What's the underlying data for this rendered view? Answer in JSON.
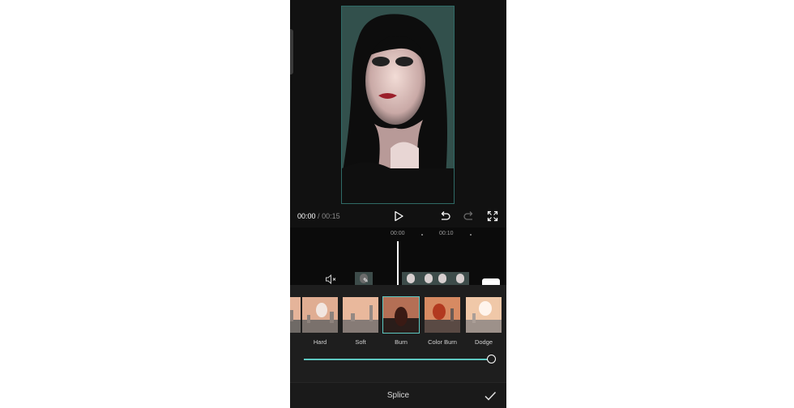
{
  "player": {
    "current_time": "00:00",
    "separator": "/",
    "total_time": "00:15"
  },
  "timeline": {
    "ruler": [
      "00:00",
      "00:10"
    ]
  },
  "blend_modes": {
    "items": [
      {
        "label": "Hard",
        "selected": false
      },
      {
        "label": "Soft",
        "selected": false
      },
      {
        "label": "Burn",
        "selected": true
      },
      {
        "label": "Color Burn",
        "selected": false
      },
      {
        "label": "Dodge",
        "selected": false
      }
    ],
    "opacity_fraction": 1.0
  },
  "bottom_bar": {
    "title": "Splice"
  },
  "colors": {
    "accent": "#5ec8c1",
    "background": "#121212",
    "panel": "#1e1e1e"
  },
  "icons": [
    "play-icon",
    "undo-icon",
    "redo-icon",
    "fullscreen-icon",
    "mute-icon",
    "check-icon"
  ]
}
